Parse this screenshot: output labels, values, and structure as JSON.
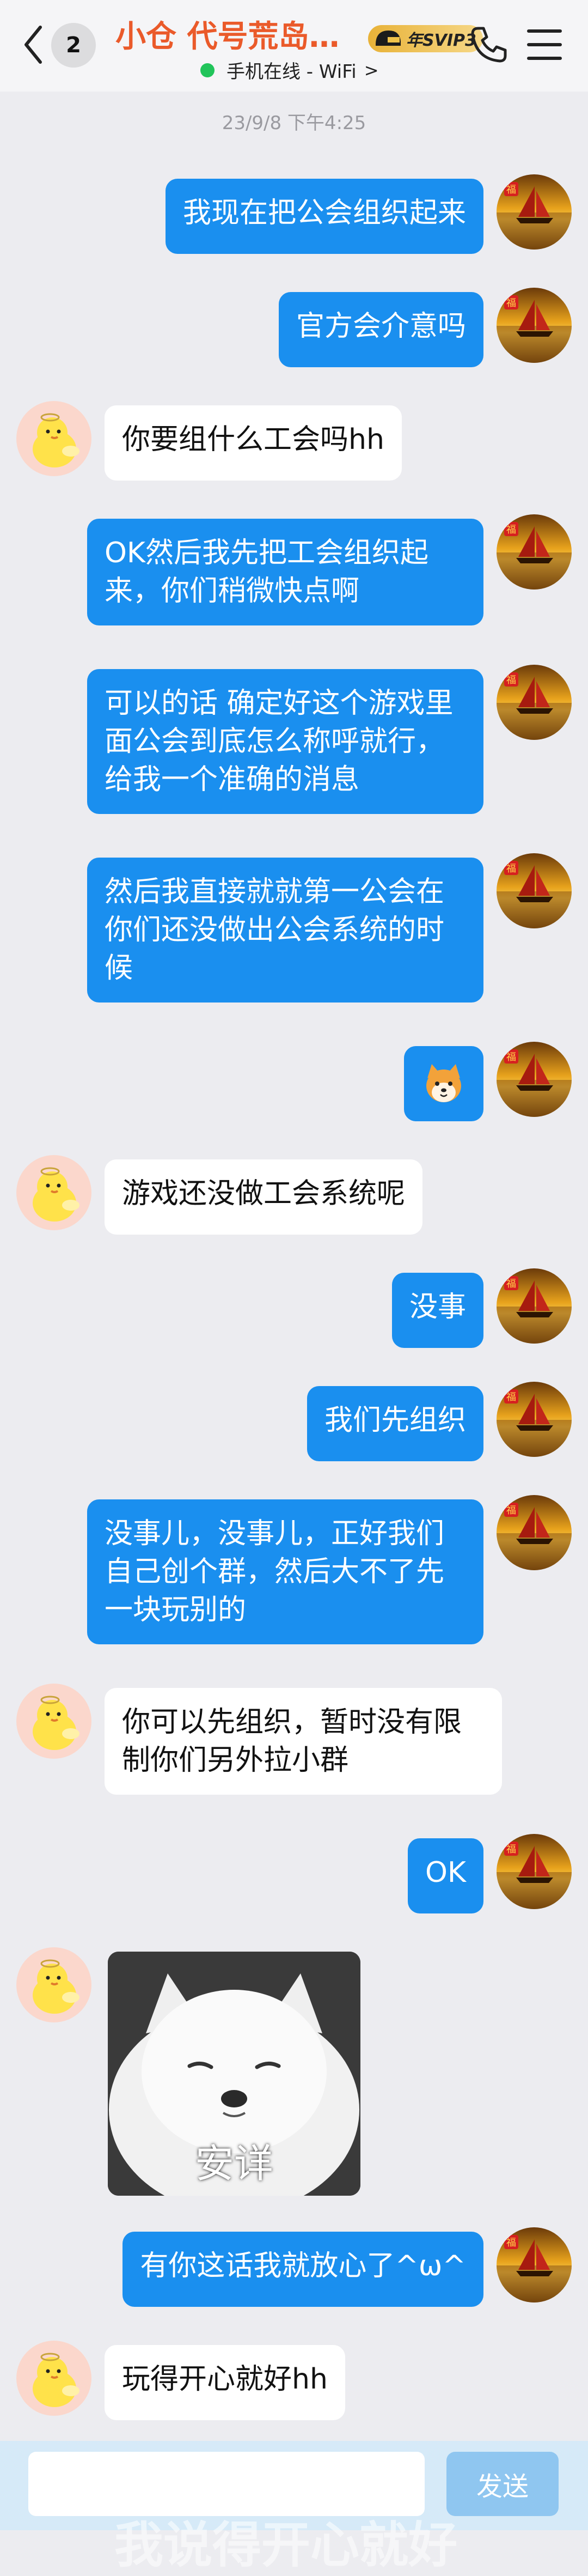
{
  "header": {
    "unread_count": "2",
    "contact_name": "小仓 代号荒岛…",
    "svip_label": "年SVIP3",
    "status_text": "手机在线 - WiFi",
    "status_chevron": ">"
  },
  "chat": {
    "timestamp": "23/9/8 下午4:25",
    "messages": [
      {
        "text": "我现在把公会组织起来"
      },
      {
        "text": "官方会介意吗"
      },
      {
        "text": "你要组什么工会吗hh"
      },
      {
        "text": "OK然后我先把工会组织起来，你们稍微快点啊"
      },
      {
        "text": "可以的话 确定好这个游戏里面公会到底怎么称呼就行，给我一个准确的消息"
      },
      {
        "text": "然后我直接就就第一公会在你们还没做出公会系统的时候"
      },
      {
        "text": "游戏还没做工会系统呢"
      },
      {
        "text": "没事"
      },
      {
        "text": "我们先组织"
      },
      {
        "text": "没事儿，没事儿，正好我们自己创个群，然后大不了先一块玩别的"
      },
      {
        "text": "你可以先组织，暂时没有限制你们另外拉小群"
      },
      {
        "text": "OK"
      },
      {
        "sticker_caption": "安详"
      },
      {
        "text": "有你这话我就放心了^ω^"
      },
      {
        "text": "玩得开心就好hh"
      }
    ]
  },
  "input": {
    "send_label": "发送",
    "background_text": "我说得开心就好"
  },
  "colors": {
    "title": "#ea5a2a",
    "outgoing_bubble": "#1a8fef",
    "incoming_bubble": "#ffffff",
    "online_dot": "#21c45a",
    "send_button": "#8fc6f0"
  }
}
